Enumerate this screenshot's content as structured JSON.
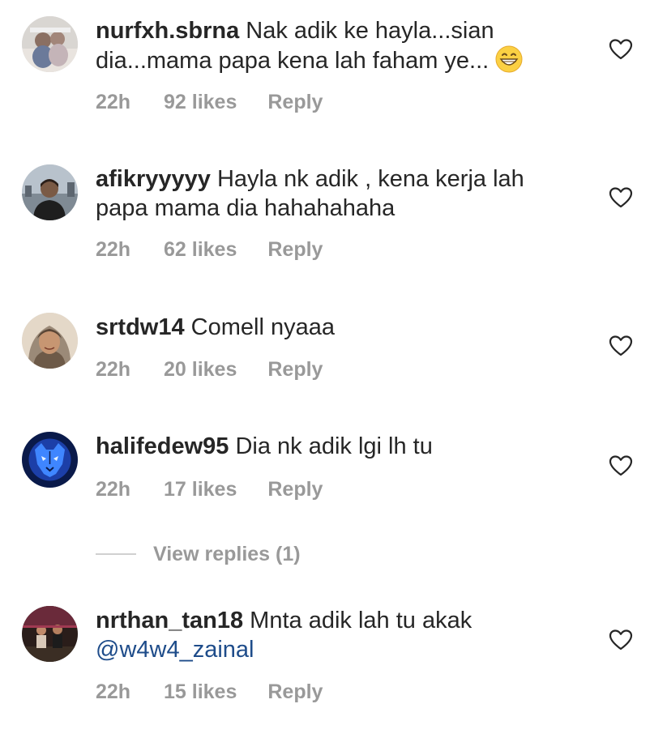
{
  "comments": [
    {
      "username": "nurfxh.sbrna",
      "text": " Nak adik ke hayla...sian dia...mama papa kena lah faham ye...",
      "emoji": "grinning-face-emoji",
      "time": "22h",
      "likes": "92 likes",
      "reply": "Reply"
    },
    {
      "username": "afikryyyyy",
      "text": " Hayla nk adik , kena kerja lah papa mama dia hahahahaha",
      "time": "22h",
      "likes": "62 likes",
      "reply": "Reply"
    },
    {
      "username": "srtdw14",
      "text": " Comell nyaaa",
      "time": "22h",
      "likes": "20 likes",
      "reply": "Reply"
    },
    {
      "username": "halifedew95",
      "text": " Dia nk adik lgi lh tu",
      "time": "22h",
      "likes": "17 likes",
      "reply": "Reply",
      "view_replies": "View replies (1)"
    },
    {
      "username": "nrthan_tan18",
      "text": " Mnta adik lah tu akak ",
      "mention": "@w4w4_zainal",
      "time": "22h",
      "likes": "15 likes",
      "reply": "Reply"
    }
  ],
  "colors": {
    "text": "#262626",
    "meta": "#999999",
    "mention": "#1e4c8a",
    "heart_outline": "#262626",
    "divider": "#d0d0d0"
  },
  "icons": {
    "like": "heart-outline-icon",
    "emoji": "grinning-face-emoji"
  }
}
